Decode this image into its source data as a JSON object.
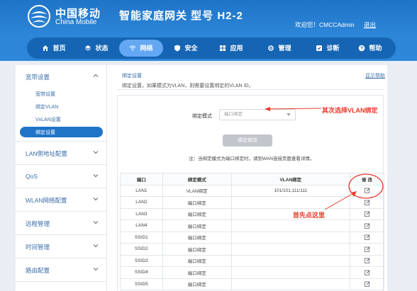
{
  "header": {
    "brand_cn": "中国移动",
    "brand_en": "China Mobile",
    "product": "智能家庭网关  型号 H2-2",
    "welcome": "欢迎您！CMCCAdmin",
    "logout": "退出"
  },
  "nav": [
    {
      "label": "首页",
      "icon": "home-icon",
      "active": false
    },
    {
      "label": "状态",
      "icon": "status-icon",
      "active": false
    },
    {
      "label": "网络",
      "icon": "wifi-icon",
      "active": true
    },
    {
      "label": "安全",
      "icon": "shield-icon",
      "active": false
    },
    {
      "label": "应用",
      "icon": "apps-icon",
      "active": false
    },
    {
      "label": "管理",
      "icon": "gear-icon",
      "active": false
    },
    {
      "label": "诊断",
      "icon": "diagnose-icon",
      "active": false
    },
    {
      "label": "帮助",
      "icon": "help-icon",
      "active": false
    }
  ],
  "sidebar": {
    "groups": [
      {
        "label": "宽带设置",
        "expanded": true
      },
      {
        "label": "LAN侧地址配置"
      },
      {
        "label": "QoS"
      },
      {
        "label": "WLAN网络配置"
      },
      {
        "label": "远程管理"
      },
      {
        "label": "时间管理"
      },
      {
        "label": "路由配置"
      }
    ],
    "sub_items": [
      {
        "label": "宽带设置"
      },
      {
        "label": "绑定VLAN"
      },
      {
        "label": "VxLAN设置"
      },
      {
        "label": "绑定设置",
        "active": true
      }
    ]
  },
  "main": {
    "title": "绑定设置",
    "help": "显示帮助",
    "desc": "绑定设置，如果模式为VLAN，则需要设置绑定的VLAN ID。",
    "mode_label": "绑定模式",
    "mode_value": "端口绑定",
    "confirm": "绑定修改",
    "note": "注：当绑定模式为端口绑定时，请到WAN连接页面查看详情。"
  },
  "table": {
    "headers": [
      "端口",
      "绑定模式",
      "VLAN绑定",
      "修 改"
    ],
    "rows": [
      {
        "port": "LAN1",
        "mode": "VLAN绑定",
        "vlan": "101/101,111/111"
      },
      {
        "port": "LAN2",
        "mode": "端口绑定",
        "vlan": ""
      },
      {
        "port": "LAN3",
        "mode": "端口绑定",
        "vlan": ""
      },
      {
        "port": "LAN4",
        "mode": "端口绑定",
        "vlan": ""
      },
      {
        "port": "SSID1",
        "mode": "端口绑定",
        "vlan": ""
      },
      {
        "port": "SSID2",
        "mode": "端口绑定",
        "vlan": ""
      },
      {
        "port": "SSID3",
        "mode": "端口绑定",
        "vlan": ""
      },
      {
        "port": "SSID4",
        "mode": "端口绑定",
        "vlan": ""
      },
      {
        "port": "SSID5",
        "mode": "端口绑定",
        "vlan": ""
      }
    ]
  },
  "annotations": {
    "step2": "其次选择VLAN绑定",
    "step1": "首先点这里"
  },
  "colors": {
    "header": "#1f74c8",
    "nav_bar": "#1565b4",
    "nav_active": "#64a8f3",
    "annotation": "#e63a2a"
  }
}
